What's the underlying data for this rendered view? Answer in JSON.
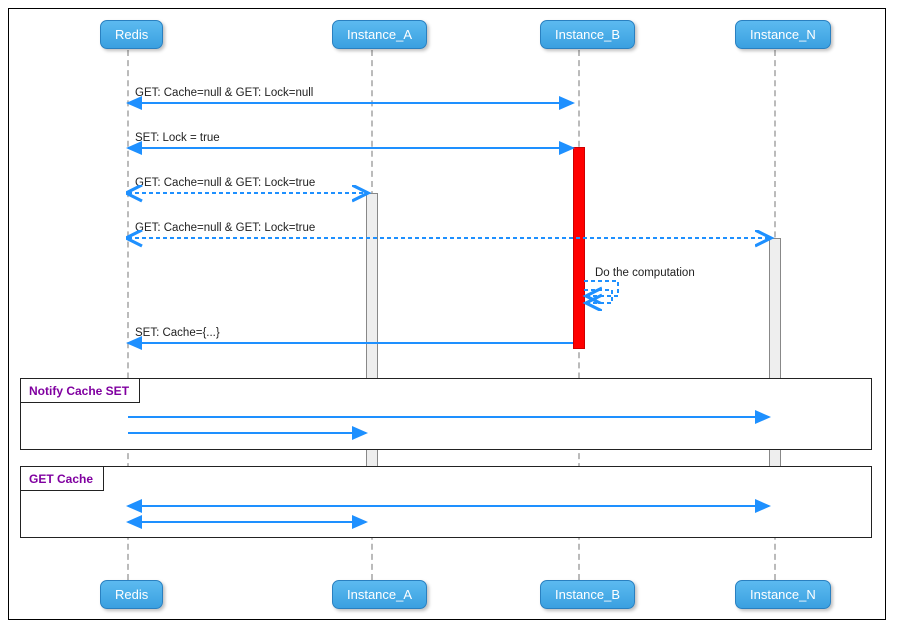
{
  "participants": {
    "redis": "Redis",
    "a": "Instance_A",
    "b": "Instance_B",
    "n": "Instance_N"
  },
  "messages": {
    "m1": "GET: Cache=null & GET: Lock=null",
    "m2": "SET: Lock = true",
    "m3": "GET: Cache=null & GET: Lock=true",
    "m4": "GET: Cache=null & GET: Lock=true",
    "m5": "Do the computation",
    "m6": "SET: Cache={...}"
  },
  "groups": {
    "g1": "Notify Cache SET",
    "g2": "GET Cache"
  },
  "chart_data": {
    "type": "sequence-diagram",
    "participants": [
      "Redis",
      "Instance_A",
      "Instance_B",
      "Instance_N"
    ],
    "events": [
      {
        "from": "Instance_B",
        "to": "Redis",
        "label": "GET: Cache=null & GET: Lock=null",
        "style": "solid",
        "direction": "bidirectional"
      },
      {
        "from": "Instance_B",
        "to": "Redis",
        "label": "SET: Lock = true",
        "style": "solid",
        "direction": "bidirectional",
        "activates": "Instance_B"
      },
      {
        "from": "Instance_A",
        "to": "Redis",
        "label": "GET: Cache=null & GET: Lock=true",
        "style": "dashed",
        "direction": "bidirectional",
        "activates": "Instance_A"
      },
      {
        "from": "Instance_N",
        "to": "Redis",
        "label": "GET: Cache=null & GET: Lock=true",
        "style": "dashed",
        "direction": "bidirectional",
        "activates": "Instance_N"
      },
      {
        "from": "Instance_B",
        "to": "Instance_B",
        "label": "Do the computation",
        "style": "dashed",
        "direction": "self"
      },
      {
        "from": "Instance_B",
        "to": "Redis",
        "label": "SET: Cache={...}",
        "style": "solid",
        "direction": "toRedis",
        "deactivates": "Instance_B"
      },
      {
        "group": "Notify Cache SET",
        "events": [
          {
            "from": "Redis",
            "to": "Instance_N",
            "style": "solid",
            "direction": "toTarget"
          },
          {
            "from": "Redis",
            "to": "Instance_A",
            "style": "solid",
            "direction": "toTarget"
          }
        ]
      },
      {
        "group": "GET Cache",
        "events": [
          {
            "from": "Instance_N",
            "to": "Redis",
            "style": "solid",
            "direction": "bidirectional",
            "deactivates": "Instance_N"
          },
          {
            "from": "Instance_A",
            "to": "Redis",
            "style": "solid",
            "direction": "bidirectional",
            "deactivates": "Instance_A"
          }
        ]
      }
    ]
  }
}
